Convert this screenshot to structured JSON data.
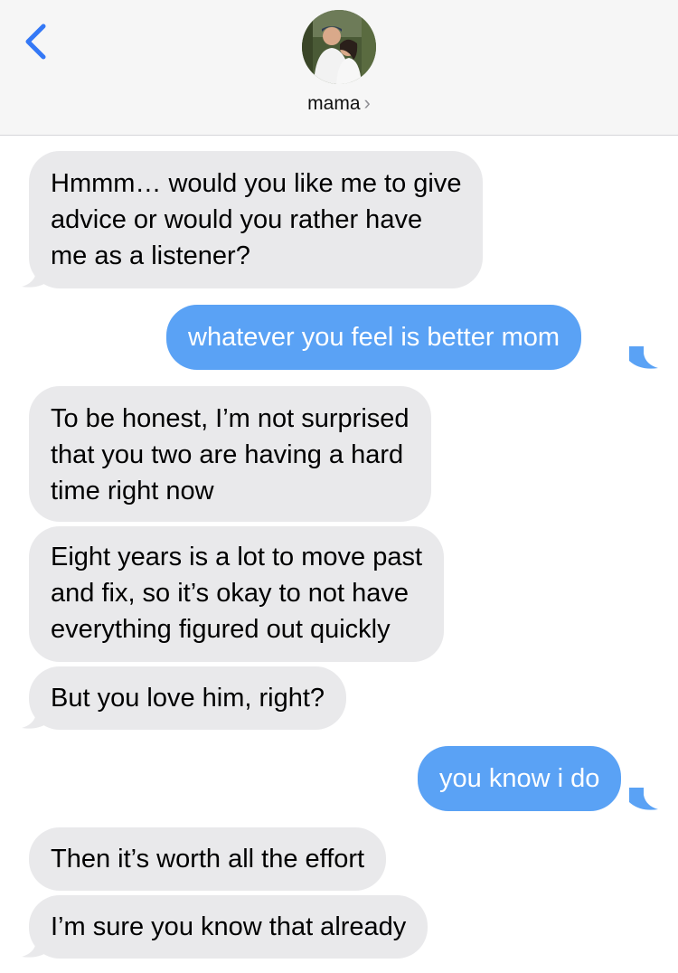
{
  "header": {
    "contact_name": "mama",
    "chevron": "›",
    "back_icon": "chevron-left-icon",
    "accent_color": "#3478f6"
  },
  "colors": {
    "incoming_bubble": "#e9e9eb",
    "outgoing_bubble": "#5aa2f5",
    "header_bg": "#f6f6f6"
  },
  "messages": [
    {
      "direction": "incoming",
      "lines": [
        "Hmmm… would you like me to give",
        "advice or would you rather have",
        "me as a listener?"
      ]
    },
    {
      "direction": "outgoing",
      "lines": [
        "whatever you feel is better mom"
      ]
    },
    {
      "direction": "incoming",
      "lines": [
        "To be honest, I’m not surprised",
        "that you two are having a hard",
        "time right now"
      ]
    },
    {
      "direction": "incoming",
      "lines": [
        "Eight years is a lot to move past",
        "and fix, so it’s okay to not have",
        "everything figured out quickly"
      ]
    },
    {
      "direction": "incoming",
      "lines": [
        "But you love him, right?"
      ]
    },
    {
      "direction": "outgoing",
      "lines": [
        "you know i do"
      ]
    },
    {
      "direction": "incoming",
      "lines": [
        "Then it’s worth all the effort"
      ]
    },
    {
      "direction": "incoming",
      "lines": [
        "I’m sure you know that already"
      ]
    }
  ]
}
